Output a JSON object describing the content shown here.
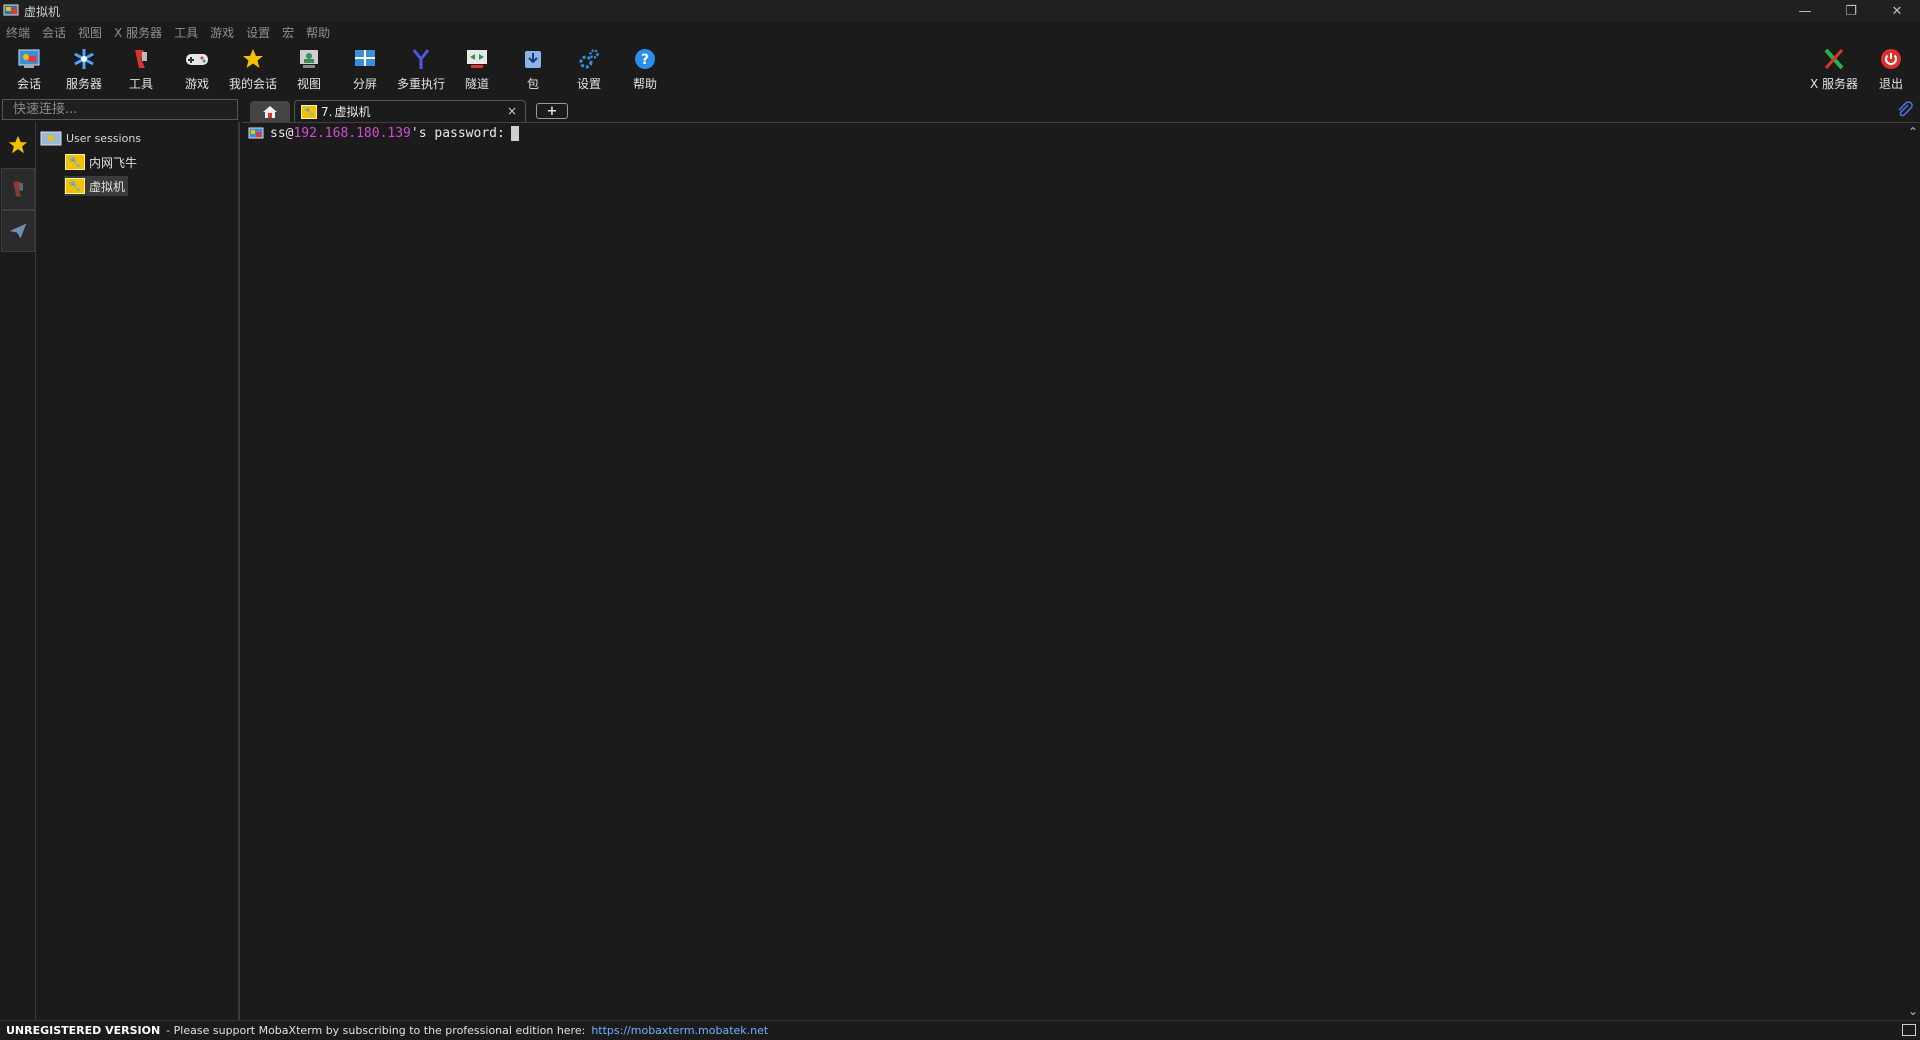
{
  "window": {
    "title": "虚拟机",
    "controls": [
      "—",
      "❐",
      "✕"
    ]
  },
  "menu": [
    "终端",
    "会话",
    "视图",
    "X 服务器",
    "工具",
    "游戏",
    "设置",
    "宏",
    "帮助"
  ],
  "toolbar": {
    "session": "会话",
    "servers": "服务器",
    "tools": "工具",
    "games": "游戏",
    "my_sessions": "我的会话",
    "view": "视图",
    "split": "分屏",
    "multiexec": "多重执行",
    "tunnel": "隧道",
    "packages": "包",
    "settings": "设置",
    "help": "帮助",
    "xserver": "X 服务器",
    "exit": "退出"
  },
  "quick_connect": {
    "placeholder": "快速连接..."
  },
  "sessions": {
    "root": "User sessions",
    "items": [
      "内网飞牛",
      "虚拟机"
    ],
    "selected": "虚拟机"
  },
  "tabs": {
    "active": {
      "number": "7.",
      "label": "虚拟机",
      "close": "×"
    },
    "new_tab": "+"
  },
  "terminal": {
    "user": "ss@",
    "host": "192.168.180.139",
    "suffix": "'s password:",
    "host_color": "#d04ed0"
  },
  "status": {
    "unregistered": "UNREGISTERED VERSION",
    "message": " -  Please support MobaXterm by subscribing to the professional edition here:",
    "link": "https://mobaxterm.mobatek.net"
  }
}
